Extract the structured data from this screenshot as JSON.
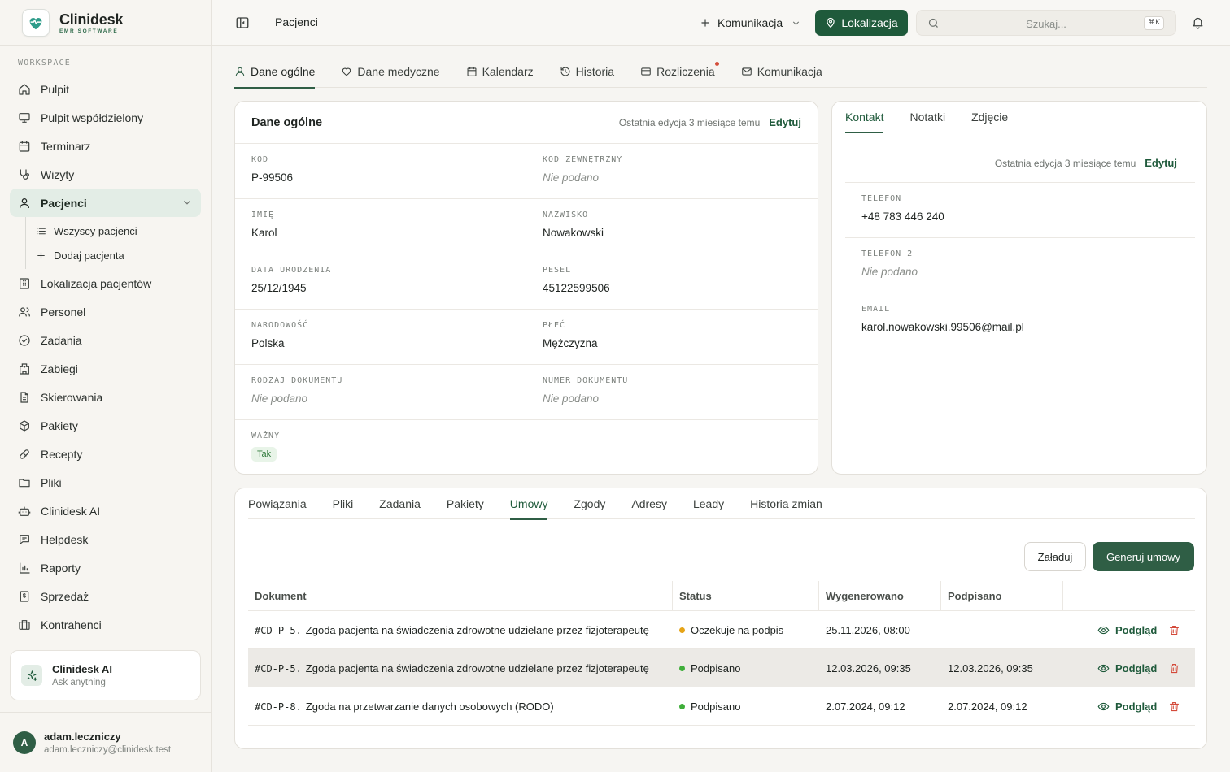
{
  "brand": {
    "name": "Clinidesk",
    "sub": "EMR SOFTWARE"
  },
  "sidebar": {
    "section": "WORKSPACE",
    "items": [
      {
        "label": "Pulpit",
        "icon": "home-icon"
      },
      {
        "label": "Pulpit współdzielony",
        "icon": "monitor-icon"
      },
      {
        "label": "Terminarz",
        "icon": "calendar-icon"
      },
      {
        "label": "Wizyty",
        "icon": "stethoscope-icon"
      },
      {
        "label": "Pacjenci",
        "icon": "user-icon"
      },
      {
        "label": "Lokalizacja pacjentów",
        "icon": "building-icon"
      },
      {
        "label": "Personel",
        "icon": "users-icon"
      },
      {
        "label": "Zadania",
        "icon": "check-circle-icon"
      },
      {
        "label": "Zabiegi",
        "icon": "hospital-icon"
      },
      {
        "label": "Skierowania",
        "icon": "document-icon"
      },
      {
        "label": "Pakiety",
        "icon": "package-icon"
      },
      {
        "label": "Recepty",
        "icon": "pill-icon"
      },
      {
        "label": "Pliki",
        "icon": "folder-icon"
      },
      {
        "label": "Clinidesk AI",
        "icon": "bot-icon"
      },
      {
        "label": "Helpdesk",
        "icon": "message-icon"
      },
      {
        "label": "Raporty",
        "icon": "chart-icon"
      },
      {
        "label": "Sprzedaż",
        "icon": "receipt-icon"
      },
      {
        "label": "Kontrahenci",
        "icon": "briefcase-icon"
      }
    ],
    "sub_items": [
      "Wszyscy pacjenci",
      "Dodaj pacjenta"
    ],
    "ai_card": {
      "title": "Clinidesk AI",
      "subtitle": "Ask anything"
    },
    "user": {
      "initial": "A",
      "name": "adam.leczniczy",
      "email": "adam.leczniczy@clinidesk.test"
    }
  },
  "topbar": {
    "title": "Pacjenci",
    "komunikacja": "Komunikacja",
    "lokalizacja": "Lokalizacja",
    "search_placeholder": "Szukaj...",
    "shortcut": "⌘K"
  },
  "main_tabs": [
    "Dane ogólne",
    "Dane medyczne",
    "Kalendarz",
    "Historia",
    "Rozliczenia",
    "Komunikacja"
  ],
  "general": {
    "title": "Dane ogólne",
    "edit_meta": "Ostatnia edycja 3 miesiące temu",
    "edit_label": "Edytuj",
    "fields": [
      {
        "label": "KOD",
        "value": "P-99506"
      },
      {
        "label": "KOD ZEWNĘTRZNY",
        "value": "Nie podano"
      },
      {
        "label": "IMIĘ",
        "value": "Karol"
      },
      {
        "label": "NAZWISKO",
        "value": "Nowakowski"
      },
      {
        "label": "DATA URODZENIA",
        "value": "25/12/1945"
      },
      {
        "label": "PESEL",
        "value": "45122599506"
      },
      {
        "label": "NARODOWOŚĆ",
        "value": "Polska"
      },
      {
        "label": "PŁEĆ",
        "value": "Mężczyzna"
      },
      {
        "label": "RODZAJ DOKUMENTU",
        "value": "Nie podano"
      },
      {
        "label": "NUMER DOKUMENTU",
        "value": "Nie podano"
      },
      {
        "label": "WAŻNY",
        "value": "Tak"
      }
    ]
  },
  "contact": {
    "tabs": [
      "Kontakt",
      "Notatki",
      "Zdjęcie"
    ],
    "edit_meta": "Ostatnia edycja 3 miesiące temu",
    "edit_label": "Edytuj",
    "fields": [
      {
        "label": "TELEFON",
        "value": "+48 783 446 240"
      },
      {
        "label": "TELEFON 2",
        "value": "Nie podano"
      },
      {
        "label": "EMAIL",
        "value": "karol.nowakowski.99506@mail.pl"
      }
    ]
  },
  "bottom": {
    "tabs": [
      "Powiązania",
      "Pliki",
      "Zadania",
      "Pakiety",
      "Umowy",
      "Zgody",
      "Adresy",
      "Leady",
      "Historia zmian"
    ],
    "load_label": "Załaduj",
    "generate_label": "Generuj umowy",
    "columns": [
      "Dokument",
      "Status",
      "Wygenerowano",
      "Podpisano"
    ],
    "view_label": "Podgląd",
    "rows": [
      {
        "code": "#CD-P-5.",
        "name": "Zgoda pacjenta na świadczenia zdrowotne udzielane przez fizjoterapeutę",
        "status": "Oczekuje na podpis",
        "status_color": "#e6a417",
        "generated": "25.11.2026, 08:00",
        "signed": "—"
      },
      {
        "code": "#CD-P-5.",
        "name": "Zgoda pacjenta na świadczenia zdrowotne udzielane przez fizjoterapeutę",
        "status": "Podpisano",
        "status_color": "#3fae3a",
        "generated": "12.03.2026, 09:35",
        "signed": "12.03.2026, 09:35"
      },
      {
        "code": "#CD-P-8.",
        "name": "Zgoda na przetwarzanie danych osobowych (RODO)",
        "status": "Podpisano",
        "status_color": "#3fae3a",
        "generated": "2.07.2024, 09:12",
        "signed": "2.07.2024, 09:12"
      }
    ]
  }
}
